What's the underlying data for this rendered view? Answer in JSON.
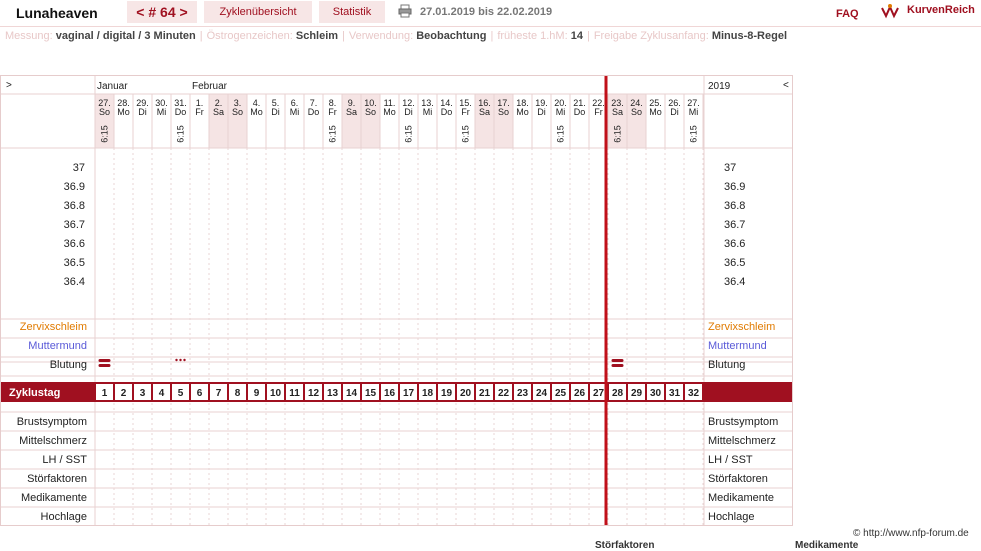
{
  "header": {
    "title": "Lunaheaven",
    "cycle_nav": "< # 64 >",
    "overview_label": "Zyklenübersicht",
    "statistics_label": "Statistik",
    "date_range": "27.01.2019 bis 22.02.2019",
    "faq_label": "FAQ",
    "brand": "KurvenReich"
  },
  "info": [
    {
      "key": "Messung:",
      "value": "vaginal / digital / 3 Minuten"
    },
    {
      "key": "Östrogenzeichen:",
      "value": "Schleim"
    },
    {
      "key": "Verwendung:",
      "value": "Beobachtung"
    },
    {
      "key": "früheste 1.hM:",
      "value": "14"
    },
    {
      "key": "Freigabe Zyklusanfang:",
      "value": "Minus-8-Regel"
    }
  ],
  "chart": {
    "left_arrow": ">",
    "right_arrow": "<",
    "year": "2019",
    "months": [
      {
        "label": "Januar",
        "day_index": 0
      },
      {
        "label": "Februar",
        "day_index": 5
      }
    ],
    "days": [
      {
        "date": "27.",
        "wd": "So",
        "time": "6:15"
      },
      {
        "date": "28.",
        "wd": "Mo",
        "time": ""
      },
      {
        "date": "29.",
        "wd": "Di",
        "time": ""
      },
      {
        "date": "30.",
        "wd": "Mi",
        "time": ""
      },
      {
        "date": "31.",
        "wd": "Do",
        "time": "6:15"
      },
      {
        "date": "1.",
        "wd": "Fr",
        "time": ""
      },
      {
        "date": "2.",
        "wd": "Sa",
        "time": ""
      },
      {
        "date": "3.",
        "wd": "So",
        "time": ""
      },
      {
        "date": "4.",
        "wd": "Mo",
        "time": ""
      },
      {
        "date": "5.",
        "wd": "Di",
        "time": ""
      },
      {
        "date": "6.",
        "wd": "Mi",
        "time": ""
      },
      {
        "date": "7.",
        "wd": "Do",
        "time": ""
      },
      {
        "date": "8.",
        "wd": "Fr",
        "time": "6:15"
      },
      {
        "date": "9.",
        "wd": "Sa",
        "time": ""
      },
      {
        "date": "10.",
        "wd": "So",
        "time": ""
      },
      {
        "date": "11.",
        "wd": "Mo",
        "time": ""
      },
      {
        "date": "12.",
        "wd": "Di",
        "time": "6:15"
      },
      {
        "date": "13.",
        "wd": "Mi",
        "time": ""
      },
      {
        "date": "14.",
        "wd": "Do",
        "time": ""
      },
      {
        "date": "15.",
        "wd": "Fr",
        "time": "6:15"
      },
      {
        "date": "16.",
        "wd": "Sa",
        "time": ""
      },
      {
        "date": "17.",
        "wd": "So",
        "time": ""
      },
      {
        "date": "18.",
        "wd": "Mo",
        "time": ""
      },
      {
        "date": "19.",
        "wd": "Di",
        "time": ""
      },
      {
        "date": "20.",
        "wd": "Mi",
        "time": "6:15"
      },
      {
        "date": "21.",
        "wd": "Do",
        "time": ""
      },
      {
        "date": "22.",
        "wd": "Fr",
        "time": ""
      },
      {
        "date": "23.",
        "wd": "Sa",
        "time": "6:15"
      },
      {
        "date": "24.",
        "wd": "So",
        "time": ""
      },
      {
        "date": "25.",
        "wd": "Mo",
        "time": ""
      },
      {
        "date": "26.",
        "wd": "Di",
        "time": ""
      },
      {
        "date": "27.",
        "wd": "Mi",
        "time": "6:15"
      }
    ],
    "temperature_labels": [
      "37",
      "36.9",
      "36.8",
      "36.7",
      "36.6",
      "36.5",
      "36.4"
    ],
    "rows_upper": [
      "Zervixschleim",
      "Muttermund",
      "Blutung"
    ],
    "cycle_day_label": "Zyklustag",
    "cycle_days": [
      "1",
      "2",
      "3",
      "4",
      "5",
      "6",
      "7",
      "8",
      "9",
      "10",
      "11",
      "12",
      "13",
      "14",
      "15",
      "16",
      "17",
      "18",
      "19",
      "20",
      "21",
      "22",
      "23",
      "24",
      "25",
      "26",
      "27",
      "28",
      "29",
      "30",
      "31",
      "32"
    ],
    "rows_lower": [
      "Brustsymptom",
      "Mittelschmerz",
      "LH / SST",
      "Störfaktoren",
      "Medikamente",
      "Hochlage"
    ],
    "bleeding": [
      {
        "day_index": 0,
        "type": "strong"
      },
      {
        "day_index": 4,
        "type": "spotting"
      },
      {
        "day_index": 27,
        "type": "strong"
      }
    ],
    "marker_day_index": 27,
    "colors": {
      "accent": "#a01020",
      "cervix": "#e07b00",
      "cervix_pos": "#5a5ad8",
      "weekend": "#f5e4e4",
      "grid": "#e8d2d2"
    }
  },
  "footer": {
    "copyright": "© http://www.nfp-forum.de",
    "cut_left": "Störfaktoren",
    "cut_right": "Medikamente"
  }
}
